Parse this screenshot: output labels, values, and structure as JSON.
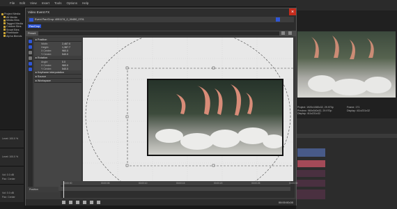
{
  "menu": [
    "File",
    "Edit",
    "View",
    "Insert",
    "Tools",
    "Options",
    "Help"
  ],
  "tree": [
    "Project Media",
    "All Media",
    "Media Bins",
    "Tagged Media",
    "Custom Bins",
    "Smart Bins",
    "Pixelblade",
    "Alpha Blends"
  ],
  "tracks": [
    {
      "level": "Level: 100.0 %"
    },
    {
      "level": "Level: 100.0 %"
    },
    {
      "level": "Vol: 0.0 dB",
      "pan": "Pan: Center"
    },
    {
      "level": "Vol: 0.0 dB",
      "pan": "Pan: Center"
    }
  ],
  "dialog": {
    "title": "Video Event FX",
    "close": "×",
    "fx_name": "Event Pan/Crop: 4051174_0_00450_0701",
    "chip": "Pan/Crop",
    "preset_label": "Preset:",
    "sections": [
      {
        "name": "Position",
        "rows": [
          {
            "k": "Width:",
            "v": "2,467.0"
          },
          {
            "k": "Height:",
            "v": "1,387.7"
          },
          {
            "k": "X Center:",
            "v": "960.0"
          },
          {
            "k": "Y Center:",
            "v": "540.0"
          }
        ]
      },
      {
        "name": "Rotation",
        "rows": [
          {
            "k": "Angle:",
            "v": "0.0"
          },
          {
            "k": "X Center:",
            "v": "960.0"
          },
          {
            "k": "Y Center:",
            "v": "540.0"
          }
        ]
      },
      {
        "name": "Keyframe interpolation",
        "rows": []
      },
      {
        "name": "Source",
        "rows": []
      },
      {
        "name": "Workspace",
        "rows": []
      }
    ],
    "timecode": "00:00:00;00",
    "position_label": "Position",
    "ruler": [
      "00:00:00",
      "00:00:05",
      "00:00:10",
      "00:00:15",
      "00:00:20",
      "00:00:25",
      "00:00:30"
    ]
  },
  "right": {
    "preview_info": [
      "Project: 1920x1080x32, 29.970p",
      "Preview: 960x540x32, 29.970p",
      "Display: 411x231x32"
    ],
    "frame_info": [
      "Frame:  171",
      "Display: 411x231x32"
    ],
    "timecode": "00:00:05;21"
  },
  "colors": {
    "accent": "#2f56d6",
    "close": "#c42b1c"
  }
}
